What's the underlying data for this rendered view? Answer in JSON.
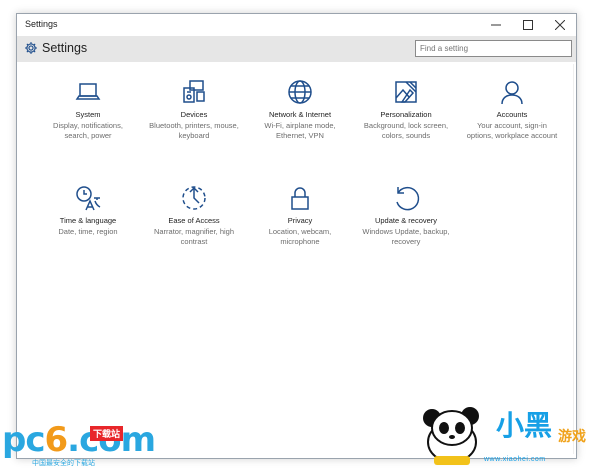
{
  "window": {
    "title": "Settings",
    "app_title": "Settings"
  },
  "search": {
    "placeholder": "Find a setting"
  },
  "tiles": [
    {
      "icon": "laptop-icon",
      "label": "System",
      "desc": "Display, notifications, search, power"
    },
    {
      "icon": "devices-icon",
      "label": "Devices",
      "desc": "Bluetooth, printers, mouse, keyboard"
    },
    {
      "icon": "globe-icon",
      "label": "Network & Internet",
      "desc": "Wi-Fi, airplane mode, Ethernet, VPN"
    },
    {
      "icon": "personalization-icon",
      "label": "Personalization",
      "desc": "Background, lock screen, colors, sounds"
    },
    {
      "icon": "person-icon",
      "label": "Accounts",
      "desc": "Your account, sign-in options, workplace account"
    },
    {
      "icon": "time-language-icon",
      "label": "Time & language",
      "desc": "Date, time, region"
    },
    {
      "icon": "ease-of-access-icon",
      "label": "Ease of Access",
      "desc": "Narrator, magnifier, high contrast"
    },
    {
      "icon": "lock-icon",
      "label": "Privacy",
      "desc": "Location, webcam, microphone"
    },
    {
      "icon": "update-icon",
      "label": "Update & recovery",
      "desc": "Windows Update, backup, recovery"
    }
  ],
  "watermark": {
    "left_logo": "pc6",
    "left_badge": "下载站",
    "left_sub": "中国最安全的下载站",
    "right_brand": "小黑",
    "right_game": "游戏",
    "right_url": "www.xiaohei.com"
  },
  "colors": {
    "accent": "#1f4e8c",
    "header_bg": "#e6e6e6",
    "desc_text": "#6d6d6d"
  }
}
